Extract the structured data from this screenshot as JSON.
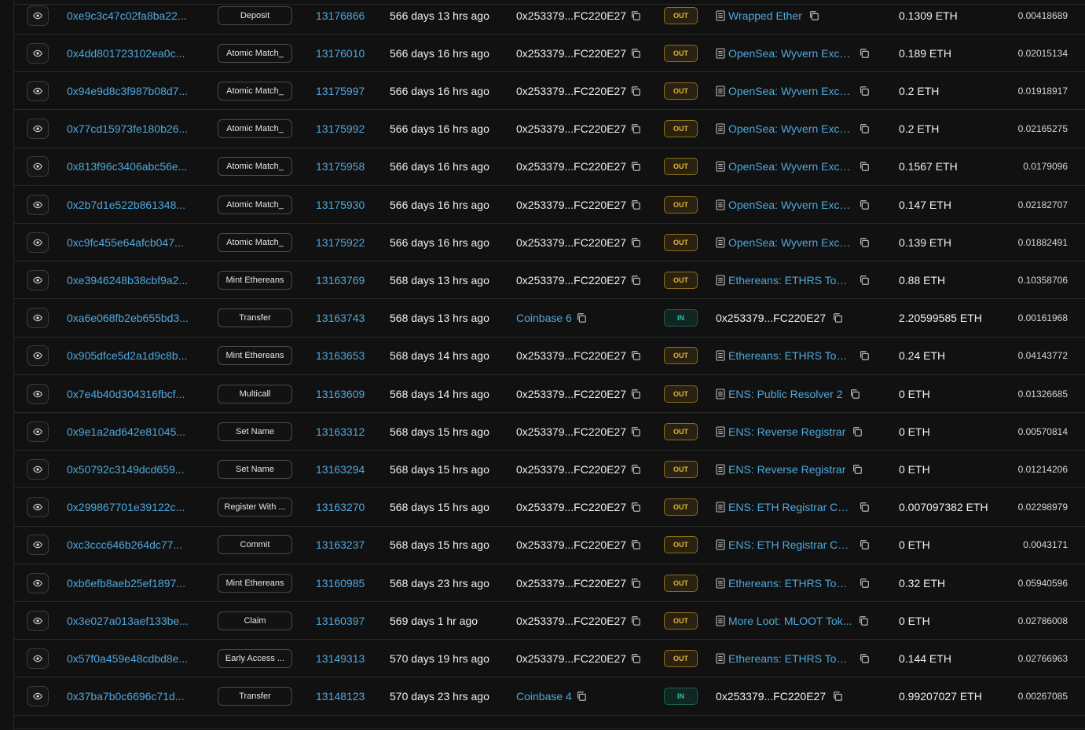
{
  "rows": [
    {
      "txhash": "0xe9c3c47c02fa8ba22...",
      "method": "Deposit",
      "block": "13176866",
      "age": "566 days 13 hrs ago",
      "from": "0x253379...FC220E27",
      "from_link": false,
      "direction": "OUT",
      "to": "Wrapped Ether",
      "to_contract": true,
      "value": "0.1309 ETH",
      "fee": "0.00418689"
    },
    {
      "txhash": "0x4dd801723102ea0c...",
      "method": "Atomic Match_",
      "block": "13176010",
      "age": "566 days 16 hrs ago",
      "from": "0x253379...FC220E27",
      "from_link": false,
      "direction": "OUT",
      "to": "OpenSea: Wyvern Exch...",
      "to_contract": true,
      "value": "0.189 ETH",
      "fee": "0.02015134"
    },
    {
      "txhash": "0x94e9d8c3f987b08d7...",
      "method": "Atomic Match_",
      "block": "13175997",
      "age": "566 days 16 hrs ago",
      "from": "0x253379...FC220E27",
      "from_link": false,
      "direction": "OUT",
      "to": "OpenSea: Wyvern Exch...",
      "to_contract": true,
      "value": "0.2 ETH",
      "fee": "0.01918917"
    },
    {
      "txhash": "0x77cd15973fe180b26...",
      "method": "Atomic Match_",
      "block": "13175992",
      "age": "566 days 16 hrs ago",
      "from": "0x253379...FC220E27",
      "from_link": false,
      "direction": "OUT",
      "to": "OpenSea: Wyvern Exch...",
      "to_contract": true,
      "value": "0.2 ETH",
      "fee": "0.02165275"
    },
    {
      "txhash": "0x813f96c3406abc56e...",
      "method": "Atomic Match_",
      "block": "13175958",
      "age": "566 days 16 hrs ago",
      "from": "0x253379...FC220E27",
      "from_link": false,
      "direction": "OUT",
      "to": "OpenSea: Wyvern Exch...",
      "to_contract": true,
      "value": "0.1567 ETH",
      "fee": "0.0179096"
    },
    {
      "txhash": "0x2b7d1e522b861348...",
      "method": "Atomic Match_",
      "block": "13175930",
      "age": "566 days 16 hrs ago",
      "from": "0x253379...FC220E27",
      "from_link": false,
      "direction": "OUT",
      "to": "OpenSea: Wyvern Exch...",
      "to_contract": true,
      "value": "0.147 ETH",
      "fee": "0.02182707"
    },
    {
      "txhash": "0xc9fc455e64afcb047...",
      "method": "Atomic Match_",
      "block": "13175922",
      "age": "566 days 16 hrs ago",
      "from": "0x253379...FC220E27",
      "from_link": false,
      "direction": "OUT",
      "to": "OpenSea: Wyvern Exch...",
      "to_contract": true,
      "value": "0.139 ETH",
      "fee": "0.01882491"
    },
    {
      "txhash": "0xe3946248b38cbf9a2...",
      "method": "Mint Ethereans",
      "block": "13163769",
      "age": "568 days 13 hrs ago",
      "from": "0x253379...FC220E27",
      "from_link": false,
      "direction": "OUT",
      "to": "Ethereans: ETHRS Token",
      "to_contract": true,
      "value": "0.88 ETH",
      "fee": "0.10358706"
    },
    {
      "txhash": "0xa6e068fb2eb655bd3...",
      "method": "Transfer",
      "block": "13163743",
      "age": "568 days 13 hrs ago",
      "from": "Coinbase 6",
      "from_link": true,
      "direction": "IN",
      "to": "0x253379...FC220E27",
      "to_contract": false,
      "value": "2.20599585 ETH",
      "fee": "0.00161968"
    },
    {
      "txhash": "0x905dfce5d2a1d9c8b...",
      "method": "Mint Ethereans",
      "block": "13163653",
      "age": "568 days 14 hrs ago",
      "from": "0x253379...FC220E27",
      "from_link": false,
      "direction": "OUT",
      "to": "Ethereans: ETHRS Token",
      "to_contract": true,
      "value": "0.24 ETH",
      "fee": "0.04143772"
    },
    {
      "txhash": "0x7e4b40d304316fbcf...",
      "method": "Multicall",
      "block": "13163609",
      "age": "568 days 14 hrs ago",
      "from": "0x253379...FC220E27",
      "from_link": false,
      "direction": "OUT",
      "to": "ENS: Public Resolver 2",
      "to_contract": true,
      "value": "0 ETH",
      "fee": "0.01326685"
    },
    {
      "txhash": "0x9e1a2ad642e81045...",
      "method": "Set Name",
      "block": "13163312",
      "age": "568 days 15 hrs ago",
      "from": "0x253379...FC220E27",
      "from_link": false,
      "direction": "OUT",
      "to": "ENS: Reverse Registrar",
      "to_contract": true,
      "value": "0 ETH",
      "fee": "0.00570814"
    },
    {
      "txhash": "0x50792c3149dcd659...",
      "method": "Set Name",
      "block": "13163294",
      "age": "568 days 15 hrs ago",
      "from": "0x253379...FC220E27",
      "from_link": false,
      "direction": "OUT",
      "to": "ENS: Reverse Registrar",
      "to_contract": true,
      "value": "0 ETH",
      "fee": "0.01214206"
    },
    {
      "txhash": "0x299867701e39122c...",
      "method": "Register With ...",
      "block": "13163270",
      "age": "568 days 15 hrs ago",
      "from": "0x253379...FC220E27",
      "from_link": false,
      "direction": "OUT",
      "to": "ENS: ETH Registrar Co...",
      "to_contract": true,
      "value": "0.007097382 ETH",
      "fee": "0.02298979"
    },
    {
      "txhash": "0xc3ccc646b264dc77...",
      "method": "Commit",
      "block": "13163237",
      "age": "568 days 15 hrs ago",
      "from": "0x253379...FC220E27",
      "from_link": false,
      "direction": "OUT",
      "to": "ENS: ETH Registrar Co...",
      "to_contract": true,
      "value": "0 ETH",
      "fee": "0.0043171"
    },
    {
      "txhash": "0xb6efb8aeb25ef1897...",
      "method": "Mint Ethereans",
      "block": "13160985",
      "age": "568 days 23 hrs ago",
      "from": "0x253379...FC220E27",
      "from_link": false,
      "direction": "OUT",
      "to": "Ethereans: ETHRS Token",
      "to_contract": true,
      "value": "0.32 ETH",
      "fee": "0.05940596"
    },
    {
      "txhash": "0x3e027a013aef133be...",
      "method": "Claim",
      "block": "13160397",
      "age": "569 days 1 hr ago",
      "from": "0x253379...FC220E27",
      "from_link": false,
      "direction": "OUT",
      "to": "More Loot: MLOOT Tok...",
      "to_contract": true,
      "value": "0 ETH",
      "fee": "0.02786008"
    },
    {
      "txhash": "0x57f0a459e48cdbd8e...",
      "method": "Early Access ...",
      "block": "13149313",
      "age": "570 days 19 hrs ago",
      "from": "0x253379...FC220E27",
      "from_link": false,
      "direction": "OUT",
      "to": "Ethereans: ETHRS Token",
      "to_contract": true,
      "value": "0.144 ETH",
      "fee": "0.02766963"
    },
    {
      "txhash": "0x37ba7b0c6696c71d...",
      "method": "Transfer",
      "block": "13148123",
      "age": "570 days 23 hrs ago",
      "from": "Coinbase 4",
      "from_link": true,
      "direction": "IN",
      "to": "0x253379...FC220E27",
      "to_contract": false,
      "value": "0.99207027 ETH",
      "fee": "0.00267085"
    }
  ],
  "icons": {
    "view": "eye-icon",
    "copy": "copy-icon",
    "contract": "document-icon"
  },
  "colors": {
    "link": "#4ea8de",
    "out_badge": "#e0b33a",
    "in_badge": "#33c2a0",
    "background": "#111111"
  }
}
